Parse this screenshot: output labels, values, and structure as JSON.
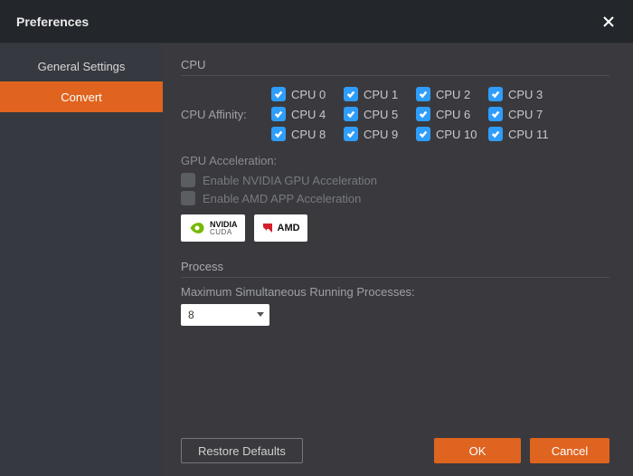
{
  "window": {
    "title": "Preferences"
  },
  "sidebar": {
    "items": [
      {
        "label": "General Settings",
        "active": false
      },
      {
        "label": "Convert",
        "active": true
      }
    ]
  },
  "cpu": {
    "section_label": "CPU",
    "affinity_label": "CPU Affinity:",
    "cores": [
      {
        "label": "CPU 0",
        "checked": true
      },
      {
        "label": "CPU 1",
        "checked": true
      },
      {
        "label": "CPU 2",
        "checked": true
      },
      {
        "label": "CPU 3",
        "checked": true
      },
      {
        "label": "CPU 4",
        "checked": true
      },
      {
        "label": "CPU 5",
        "checked": true
      },
      {
        "label": "CPU 6",
        "checked": true
      },
      {
        "label": "CPU 7",
        "checked": true
      },
      {
        "label": "CPU 8",
        "checked": true
      },
      {
        "label": "CPU 9",
        "checked": true
      },
      {
        "label": "CPU 10",
        "checked": true
      },
      {
        "label": "CPU 11",
        "checked": true
      }
    ]
  },
  "gpu": {
    "section_label": "GPU Acceleration:",
    "nvidia_option": "Enable NVIDIA GPU Acceleration",
    "amd_option": "Enable AMD APP Acceleration",
    "nvidia_badge_top": "NVIDIA",
    "nvidia_badge_bottom": "CUDA",
    "amd_badge": "AMD",
    "colors": {
      "nvidia": "#76b900",
      "amd": "#d41f2a"
    }
  },
  "process": {
    "section_label": "Process",
    "max_label": "Maximum Simultaneous Running Processes:",
    "selected": "8"
  },
  "buttons": {
    "restore": "Restore Defaults",
    "ok": "OK",
    "cancel": "Cancel"
  }
}
